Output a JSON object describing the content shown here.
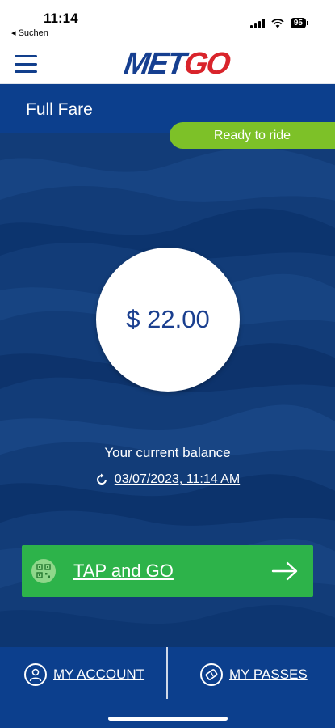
{
  "status": {
    "time": "11:14",
    "back_app": "◂ Suchen",
    "battery": "95"
  },
  "header": {
    "logo_part1": "MET",
    "logo_part2": "GO"
  },
  "card": {
    "fare_type": "Full Fare",
    "status": "Ready to ride",
    "balance": "$ 22.00",
    "balance_label": "Your current balance",
    "updated": "03/07/2023, 11:14 AM"
  },
  "actions": {
    "tap_label": "TAP and GO"
  },
  "bottom_nav": {
    "account_label": "MY ACCOUNT",
    "passes_label": "MY PASSES"
  },
  "colors": {
    "primary": "#0c3f8d",
    "green": "#2db34a",
    "ready": "#7dc128",
    "logo_red": "#d9242b"
  }
}
